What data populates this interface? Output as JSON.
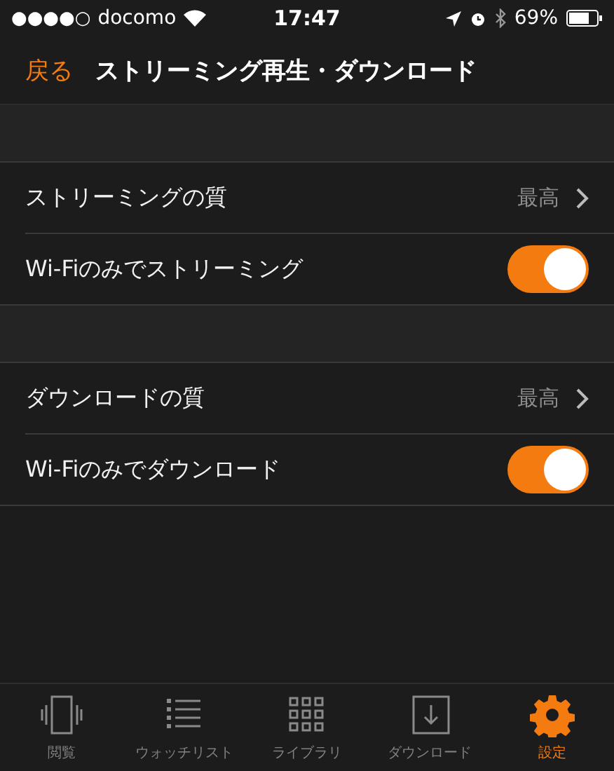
{
  "status_bar": {
    "signal_dots": "●●●●○",
    "carrier": "docomo",
    "time": "17:47",
    "battery": "69%"
  },
  "nav": {
    "back": "戻る",
    "title": "ストリーミング再生・ダウンロード"
  },
  "sections": [
    {
      "rows": [
        {
          "kind": "value",
          "label": "ストリーミングの質",
          "value": "最高"
        },
        {
          "kind": "toggle",
          "label": "Wi-Fiのみでストリーミング",
          "on": true
        }
      ]
    },
    {
      "rows": [
        {
          "kind": "value",
          "label": "ダウンロードの質",
          "value": "最高"
        },
        {
          "kind": "toggle",
          "label": "Wi-Fiのみでダウンロード",
          "on": true
        }
      ]
    }
  ],
  "tabs": [
    {
      "kind": "browse",
      "label": "閲覧",
      "selected": false
    },
    {
      "kind": "watchlist",
      "label": "ウォッチリスト",
      "selected": false
    },
    {
      "kind": "library",
      "label": "ライブラリ",
      "selected": false
    },
    {
      "kind": "download",
      "label": "ダウンロード",
      "selected": false
    },
    {
      "kind": "settings",
      "label": "設定",
      "selected": true
    }
  ]
}
